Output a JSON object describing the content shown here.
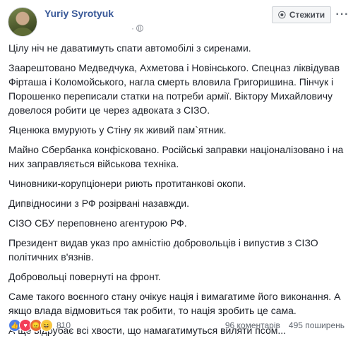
{
  "header": {
    "author_name": "Yuriy Syrotyuk",
    "privacy_separator": "·",
    "follow_label": "Стежити",
    "more_label": "···"
  },
  "post": {
    "paragraphs": [
      "Цілу ніч не даватимуть спати автомобілі з сиренами.",
      "Заарештовано Медведчука, Ахметова і Новінського. Спецназ ліквідував Фірташа і Коломойського, нагла смерть вловила Григоришина. Пінчук і Порошенко переписали статки на потреби армії. Віктору Михайловичу довелося робити це через адвоката з СІЗО.",
      "Яценюка вмурують у Стіну як живий пам`ятник.",
      "Майно Сбербанка конфісковано. Російські заправки націоналізовано і на них заправляється військова техніка.",
      "Чиновники-корупціонери риють протитанкові окопи.",
      "Дипвідносини з РФ розірвані назавжди.",
      "СІЗО СБУ переповнено агентурою РФ.",
      "Президент видав указ про амністію добровольців і випустив з СІЗО політичних в'язнів.",
      "Добровольці повернуті на фронт.",
      "Саме такого воєнного стану очікує нація і вимагатиме його виконання. А якщо влада відмовиться так робити, то нація зробить це сама.",
      "А ще відрубає всі хвости, що намагатимуться виляти псом..."
    ]
  },
  "footer": {
    "reactions": [
      {
        "name": "like",
        "glyph": "👍",
        "color": "#4f7fe5"
      },
      {
        "name": "love",
        "glyph": "♥",
        "color": "#f33e58"
      },
      {
        "name": "angry",
        "glyph": "😠",
        "color": "#e86a35"
      },
      {
        "name": "haha",
        "glyph": "😆",
        "color": "#f7c744"
      }
    ],
    "reaction_count": "810",
    "comments": "96 коментарів",
    "shares": "495 поширень"
  },
  "colors": {
    "author_link": "#385898",
    "body_text": "#1d2129",
    "meta_text": "#90949c"
  }
}
